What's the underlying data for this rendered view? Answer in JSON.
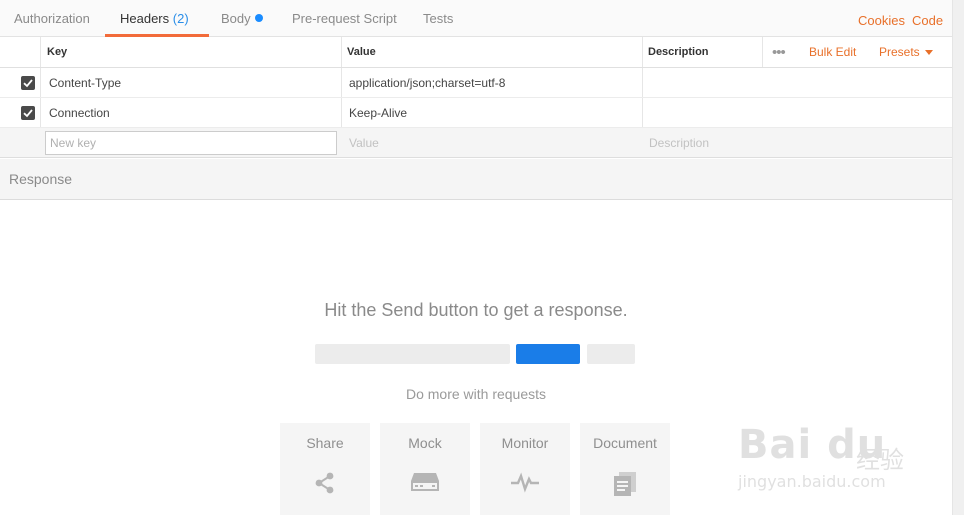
{
  "tabs": [
    {
      "label": "Authorization",
      "count": "",
      "dot": false,
      "active": false
    },
    {
      "label": "Headers",
      "count": "(2)",
      "dot": false,
      "active": true
    },
    {
      "label": "Body",
      "count": "",
      "dot": true,
      "active": false
    },
    {
      "label": "Pre-request Script",
      "count": "",
      "dot": false,
      "active": false
    },
    {
      "label": "Tests",
      "count": "",
      "dot": false,
      "active": false
    }
  ],
  "right_links": {
    "cookies": "Cookies",
    "code": "Code"
  },
  "headers_table": {
    "columns": {
      "key": "Key",
      "value": "Value",
      "description": "Description"
    },
    "more_icon": "more-dots-icon",
    "bulk_edit": "Bulk Edit",
    "presets": "Presets",
    "rows": [
      {
        "checked": true,
        "key": "Content-Type",
        "value": "application/json;charset=utf-8",
        "description": ""
      },
      {
        "checked": true,
        "key": "Connection",
        "value": "Keep-Alive",
        "description": ""
      }
    ],
    "new_row": {
      "key_placeholder": "New key",
      "value_placeholder": "Value",
      "description_placeholder": "Description"
    }
  },
  "response": {
    "title": "Response",
    "empty_message": "Hit the Send button to get a response.",
    "do_more": "Do more with requests",
    "cards": [
      {
        "label": "Share",
        "icon": "share-icon"
      },
      {
        "label": "Mock",
        "icon": "mock-server-icon"
      },
      {
        "label": "Monitor",
        "icon": "monitor-pulse-icon"
      },
      {
        "label": "Document",
        "icon": "document-icon"
      }
    ]
  },
  "watermark": {
    "brand": "Bai du",
    "cn": "经验",
    "url": "jingyan.baidu.com"
  },
  "colors": {
    "accent": "#f26b3a",
    "link": "#e8702a",
    "count": "#2a8ee8",
    "send_bar": "#1a7de8"
  }
}
